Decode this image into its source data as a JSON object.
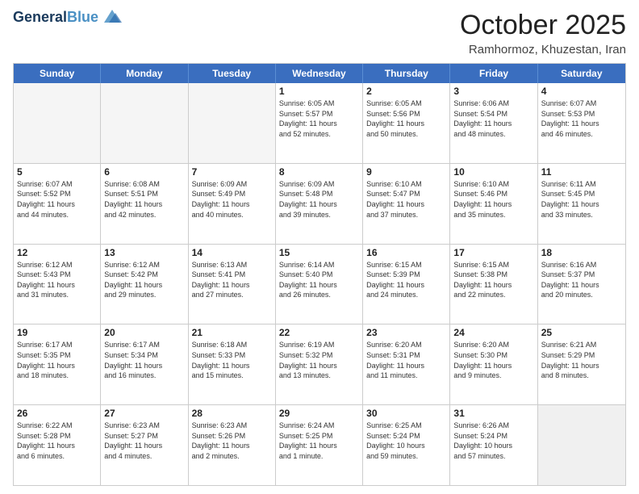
{
  "header": {
    "logo_line1": "General",
    "logo_line2": "Blue",
    "month": "October 2025",
    "location": "Ramhormoz, Khuzestan, Iran"
  },
  "weekdays": [
    "Sunday",
    "Monday",
    "Tuesday",
    "Wednesday",
    "Thursday",
    "Friday",
    "Saturday"
  ],
  "rows": [
    [
      {
        "day": "",
        "info": "",
        "empty": true
      },
      {
        "day": "",
        "info": "",
        "empty": true
      },
      {
        "day": "",
        "info": "",
        "empty": true
      },
      {
        "day": "1",
        "info": "Sunrise: 6:05 AM\nSunset: 5:57 PM\nDaylight: 11 hours\nand 52 minutes."
      },
      {
        "day": "2",
        "info": "Sunrise: 6:05 AM\nSunset: 5:56 PM\nDaylight: 11 hours\nand 50 minutes."
      },
      {
        "day": "3",
        "info": "Sunrise: 6:06 AM\nSunset: 5:54 PM\nDaylight: 11 hours\nand 48 minutes."
      },
      {
        "day": "4",
        "info": "Sunrise: 6:07 AM\nSunset: 5:53 PM\nDaylight: 11 hours\nand 46 minutes."
      }
    ],
    [
      {
        "day": "5",
        "info": "Sunrise: 6:07 AM\nSunset: 5:52 PM\nDaylight: 11 hours\nand 44 minutes."
      },
      {
        "day": "6",
        "info": "Sunrise: 6:08 AM\nSunset: 5:51 PM\nDaylight: 11 hours\nand 42 minutes."
      },
      {
        "day": "7",
        "info": "Sunrise: 6:09 AM\nSunset: 5:49 PM\nDaylight: 11 hours\nand 40 minutes."
      },
      {
        "day": "8",
        "info": "Sunrise: 6:09 AM\nSunset: 5:48 PM\nDaylight: 11 hours\nand 39 minutes."
      },
      {
        "day": "9",
        "info": "Sunrise: 6:10 AM\nSunset: 5:47 PM\nDaylight: 11 hours\nand 37 minutes."
      },
      {
        "day": "10",
        "info": "Sunrise: 6:10 AM\nSunset: 5:46 PM\nDaylight: 11 hours\nand 35 minutes."
      },
      {
        "day": "11",
        "info": "Sunrise: 6:11 AM\nSunset: 5:45 PM\nDaylight: 11 hours\nand 33 minutes."
      }
    ],
    [
      {
        "day": "12",
        "info": "Sunrise: 6:12 AM\nSunset: 5:43 PM\nDaylight: 11 hours\nand 31 minutes."
      },
      {
        "day": "13",
        "info": "Sunrise: 6:12 AM\nSunset: 5:42 PM\nDaylight: 11 hours\nand 29 minutes."
      },
      {
        "day": "14",
        "info": "Sunrise: 6:13 AM\nSunset: 5:41 PM\nDaylight: 11 hours\nand 27 minutes."
      },
      {
        "day": "15",
        "info": "Sunrise: 6:14 AM\nSunset: 5:40 PM\nDaylight: 11 hours\nand 26 minutes."
      },
      {
        "day": "16",
        "info": "Sunrise: 6:15 AM\nSunset: 5:39 PM\nDaylight: 11 hours\nand 24 minutes."
      },
      {
        "day": "17",
        "info": "Sunrise: 6:15 AM\nSunset: 5:38 PM\nDaylight: 11 hours\nand 22 minutes."
      },
      {
        "day": "18",
        "info": "Sunrise: 6:16 AM\nSunset: 5:37 PM\nDaylight: 11 hours\nand 20 minutes."
      }
    ],
    [
      {
        "day": "19",
        "info": "Sunrise: 6:17 AM\nSunset: 5:35 PM\nDaylight: 11 hours\nand 18 minutes."
      },
      {
        "day": "20",
        "info": "Sunrise: 6:17 AM\nSunset: 5:34 PM\nDaylight: 11 hours\nand 16 minutes."
      },
      {
        "day": "21",
        "info": "Sunrise: 6:18 AM\nSunset: 5:33 PM\nDaylight: 11 hours\nand 15 minutes."
      },
      {
        "day": "22",
        "info": "Sunrise: 6:19 AM\nSunset: 5:32 PM\nDaylight: 11 hours\nand 13 minutes."
      },
      {
        "day": "23",
        "info": "Sunrise: 6:20 AM\nSunset: 5:31 PM\nDaylight: 11 hours\nand 11 minutes."
      },
      {
        "day": "24",
        "info": "Sunrise: 6:20 AM\nSunset: 5:30 PM\nDaylight: 11 hours\nand 9 minutes."
      },
      {
        "day": "25",
        "info": "Sunrise: 6:21 AM\nSunset: 5:29 PM\nDaylight: 11 hours\nand 8 minutes."
      }
    ],
    [
      {
        "day": "26",
        "info": "Sunrise: 6:22 AM\nSunset: 5:28 PM\nDaylight: 11 hours\nand 6 minutes."
      },
      {
        "day": "27",
        "info": "Sunrise: 6:23 AM\nSunset: 5:27 PM\nDaylight: 11 hours\nand 4 minutes."
      },
      {
        "day": "28",
        "info": "Sunrise: 6:23 AM\nSunset: 5:26 PM\nDaylight: 11 hours\nand 2 minutes."
      },
      {
        "day": "29",
        "info": "Sunrise: 6:24 AM\nSunset: 5:25 PM\nDaylight: 11 hours\nand 1 minute."
      },
      {
        "day": "30",
        "info": "Sunrise: 6:25 AM\nSunset: 5:24 PM\nDaylight: 10 hours\nand 59 minutes."
      },
      {
        "day": "31",
        "info": "Sunrise: 6:26 AM\nSunset: 5:24 PM\nDaylight: 10 hours\nand 57 minutes."
      },
      {
        "day": "",
        "info": "",
        "empty": true,
        "shaded": true
      }
    ]
  ]
}
